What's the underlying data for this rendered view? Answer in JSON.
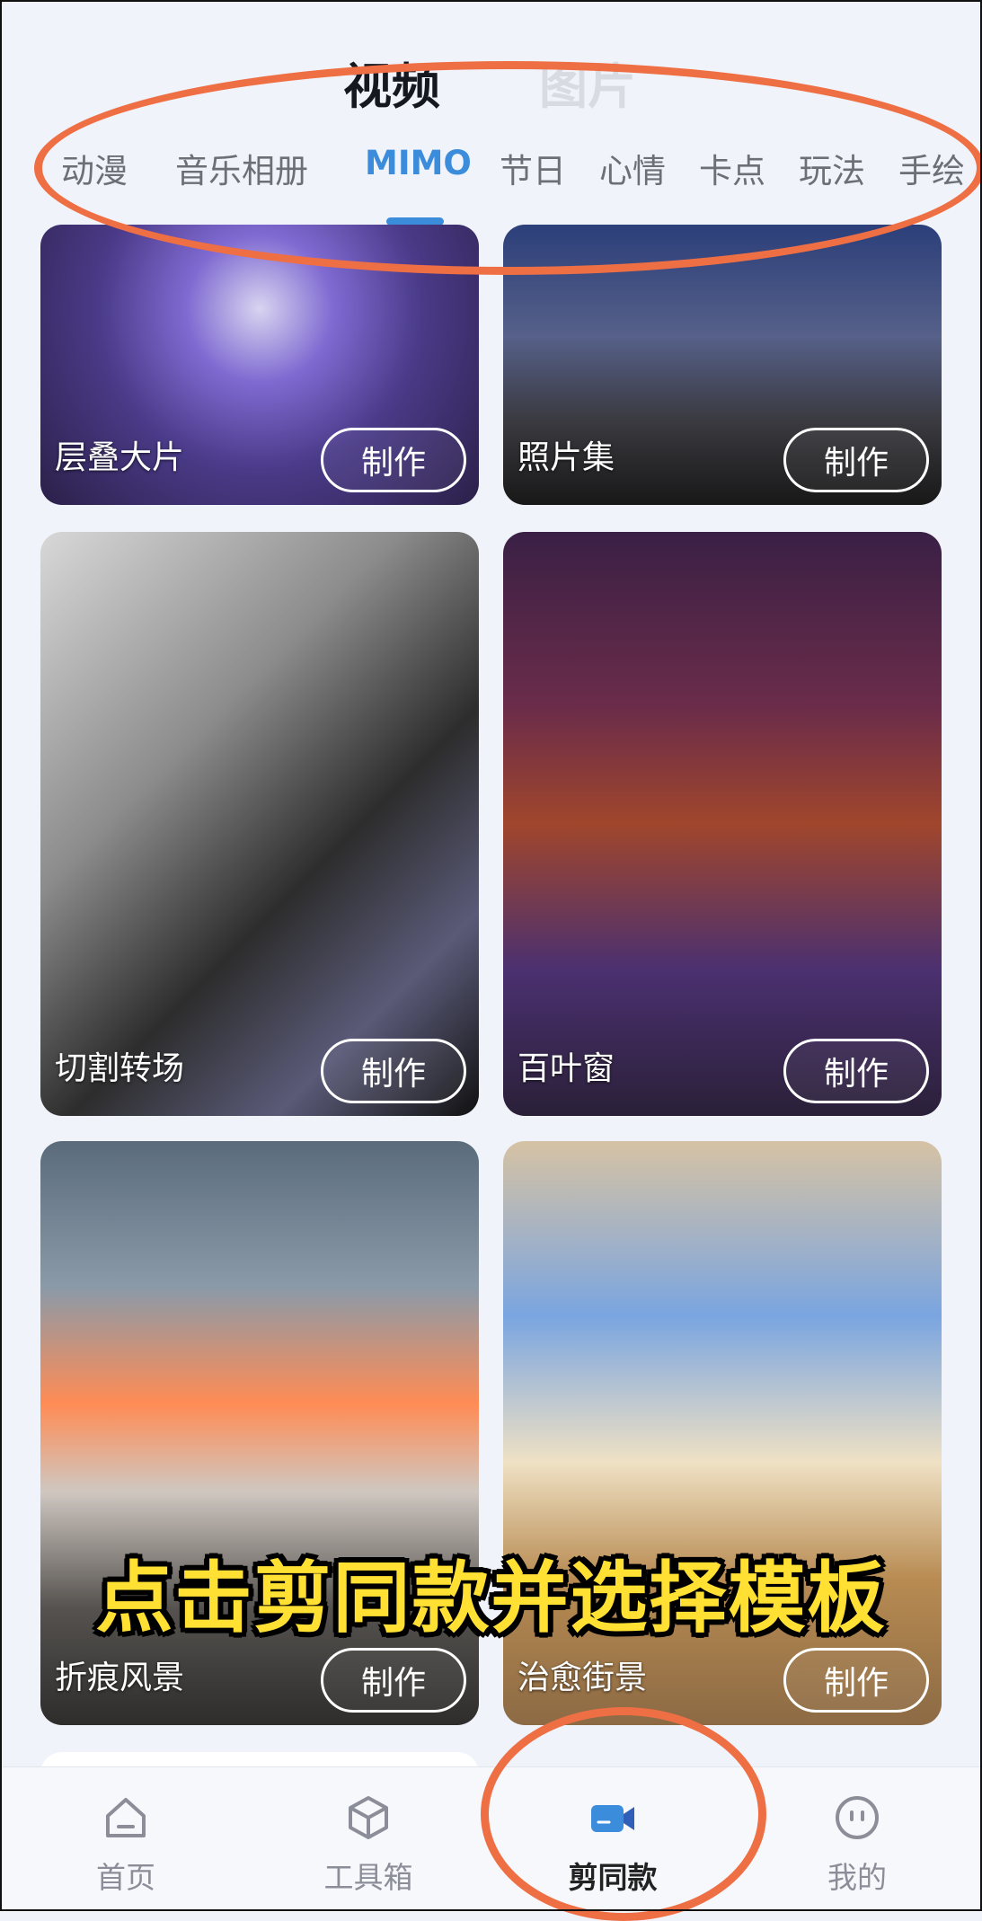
{
  "top_tabs": [
    {
      "label": "视频",
      "active": true
    },
    {
      "label": "图片",
      "active": false
    }
  ],
  "categories": [
    {
      "label": "动漫"
    },
    {
      "label": "音乐相册"
    },
    {
      "label": "MIMO",
      "active": true
    },
    {
      "label": "节日"
    },
    {
      "label": "心情"
    },
    {
      "label": "卡点"
    },
    {
      "label": "玩法"
    },
    {
      "label": "手绘"
    }
  ],
  "templates": [
    {
      "title": "层叠大片",
      "button": "制作"
    },
    {
      "title": "照片集",
      "button": "制作"
    },
    {
      "title": "切割转场",
      "button": "制作"
    },
    {
      "title": "百叶窗",
      "button": "制作"
    },
    {
      "title": "折痕风景",
      "button": "制作"
    },
    {
      "title": "治愈街景",
      "button": "制作"
    }
  ],
  "overlay_caption": "点击剪同款并选择模板",
  "bottom_nav": [
    {
      "label": "首页",
      "icon": "home-icon"
    },
    {
      "label": "工具箱",
      "icon": "toolbox-cube-icon"
    },
    {
      "label": "剪同款",
      "icon": "video-camera-icon",
      "active": true
    },
    {
      "label": "我的",
      "icon": "profile-face-icon"
    }
  ],
  "colors": {
    "accent": "#3c8cdc",
    "annotation": "#ef6f45",
    "caption_yellow": "#ffe033"
  }
}
